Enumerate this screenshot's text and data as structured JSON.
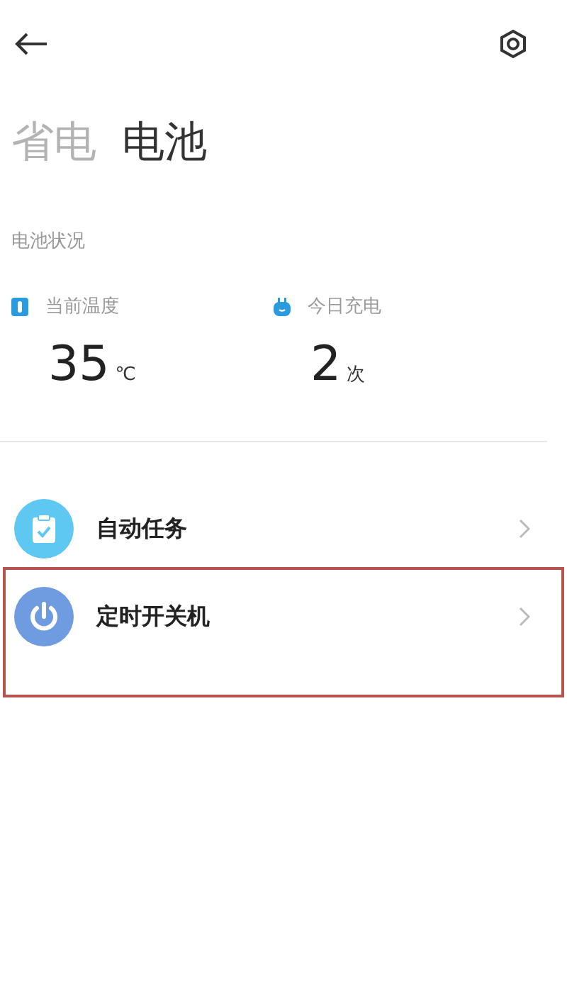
{
  "tabs": [
    {
      "label": "省电",
      "selected": false
    },
    {
      "label": "电池",
      "selected": true
    }
  ],
  "section_title": "电池状况",
  "stats": [
    {
      "kind": "temperature",
      "label": "当前温度",
      "value": "35",
      "unit": "℃"
    },
    {
      "kind": "charge",
      "label": "今日充电",
      "value": "2",
      "unit": "次"
    }
  ],
  "items": [
    {
      "kind": "task",
      "label": "自动任务",
      "highlighted": false
    },
    {
      "kind": "power",
      "label": "定时开关机",
      "highlighted": true
    }
  ]
}
